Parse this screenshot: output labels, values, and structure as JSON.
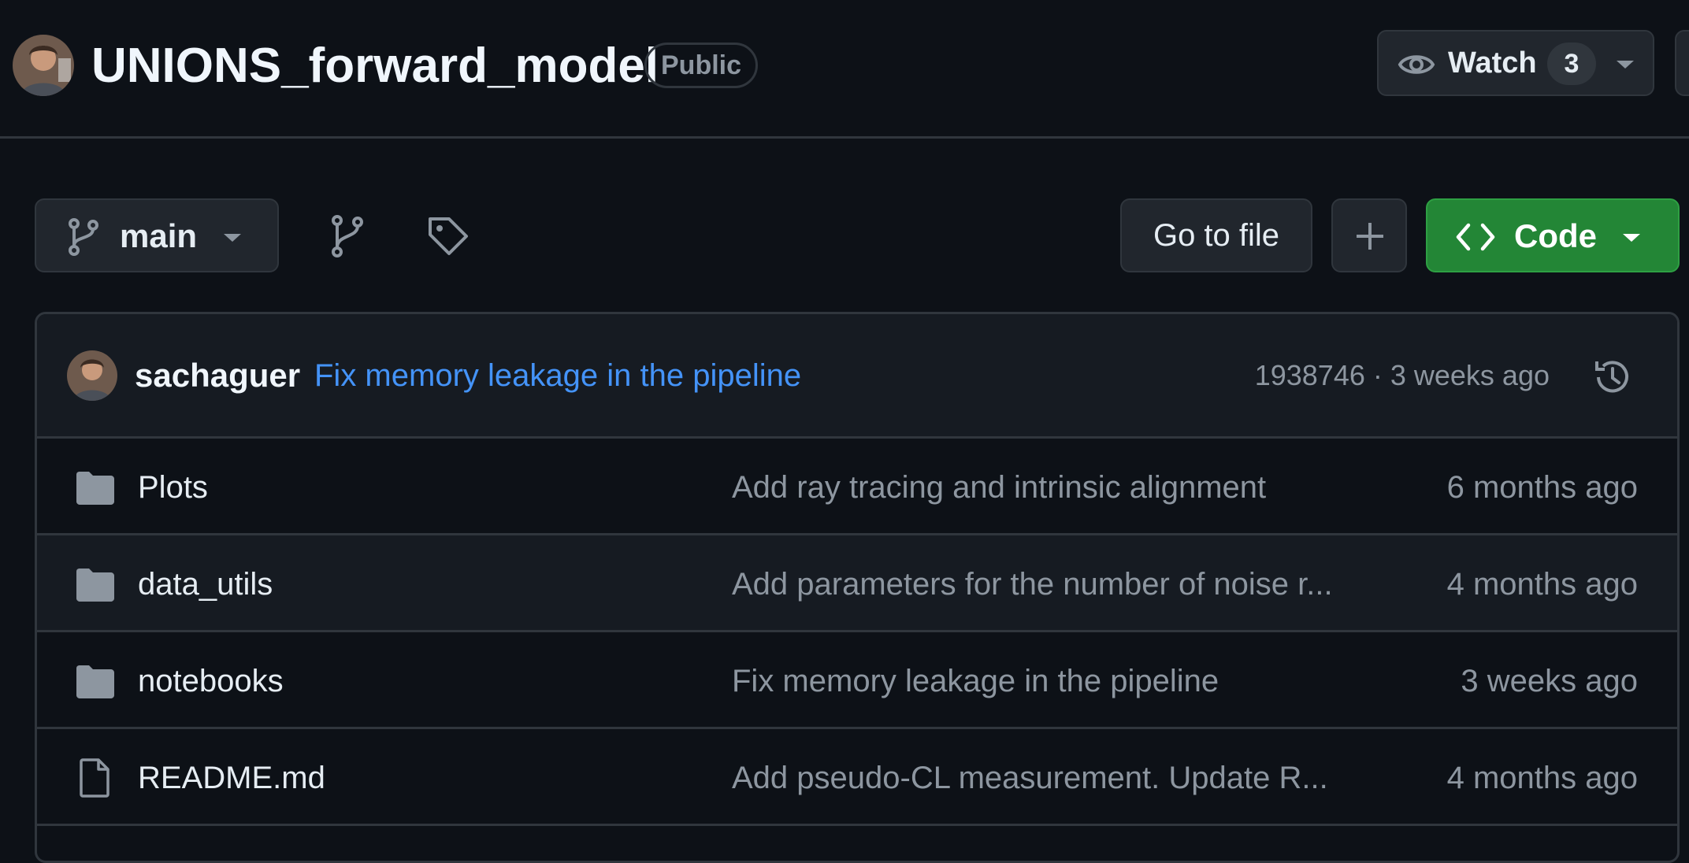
{
  "repo": {
    "name": "UNIONS_forward_model",
    "visibility": "Public",
    "watch_label": "Watch",
    "watch_count": "3"
  },
  "toolbar": {
    "branch": "main",
    "go_to_file_label": "Go to file",
    "code_label": "Code"
  },
  "latest_commit": {
    "author": "sachaguer",
    "message": "Fix memory leakage in the pipeline",
    "meta": "1938746 · 3 weeks ago"
  },
  "files": [
    {
      "name": "Plots",
      "type": "folder",
      "message": "Add ray tracing and intrinsic alignment",
      "age": "6 months ago"
    },
    {
      "name": "data_utils",
      "type": "folder",
      "message": "Add parameters for the number of noise r...",
      "age": "4 months ago"
    },
    {
      "name": "notebooks",
      "type": "folder",
      "message": "Fix memory leakage in the pipeline",
      "age": "3 weeks ago"
    },
    {
      "name": "README.md",
      "type": "file",
      "message": "Add pseudo-CL measurement. Update R...",
      "age": "4 months ago"
    }
  ],
  "colors": {
    "background": "#0d1117",
    "border": "#30363d",
    "link": "#4493f8",
    "code_button": "#238636",
    "muted_text": "#8d96a0"
  }
}
